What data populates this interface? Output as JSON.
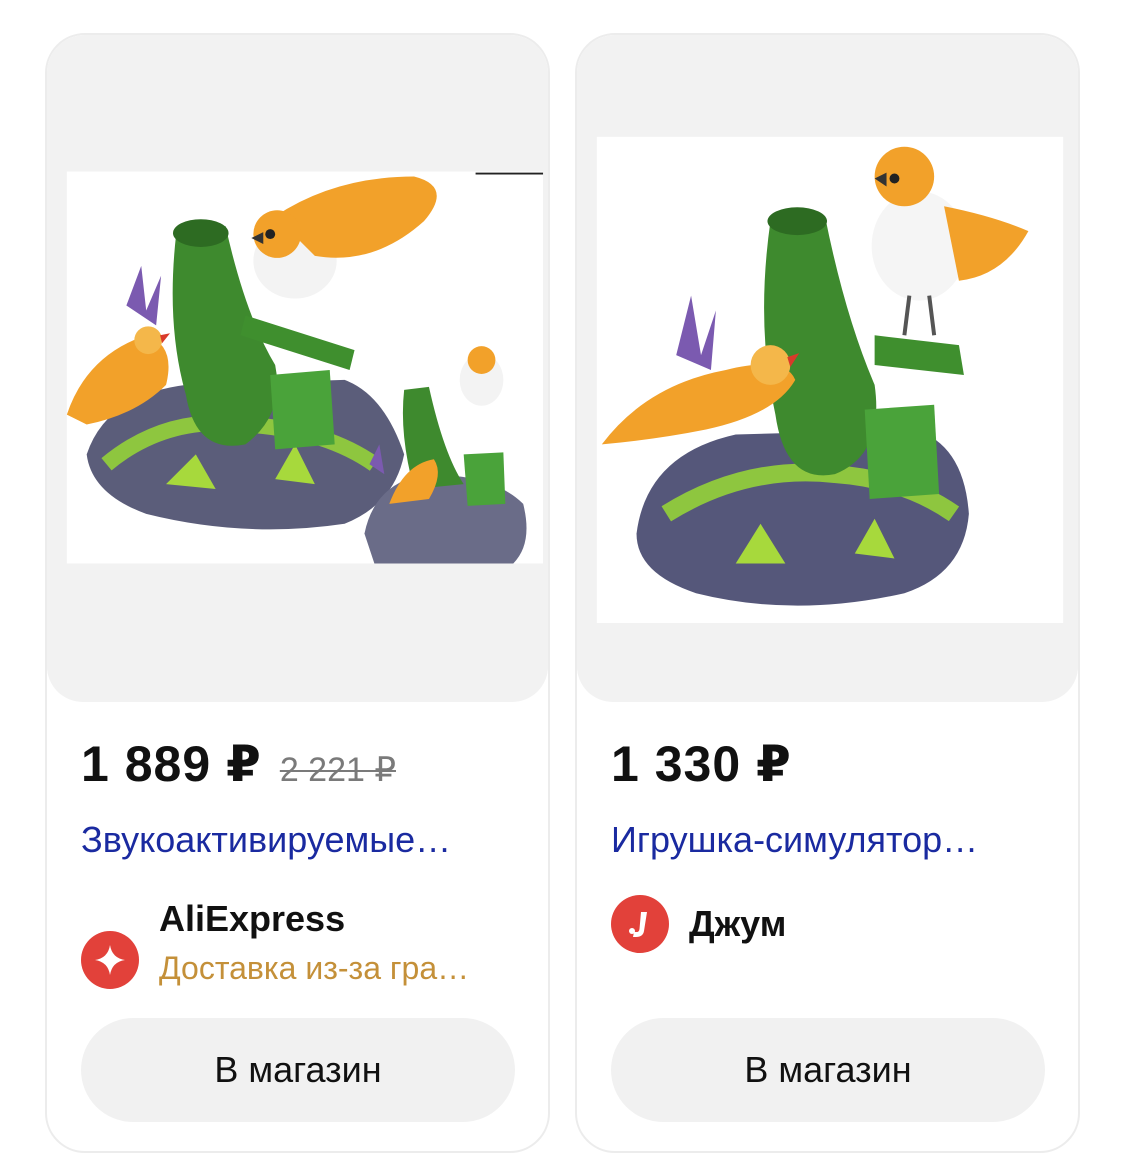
{
  "products": [
    {
      "price": "1 889 ₽",
      "old_price": "2 221 ₽",
      "title": "Звукоактивируемые…",
      "shop_name": "AliExpress",
      "shop_note": "Доставка из-за гра…",
      "button_label": "В магазин",
      "shop_logo_icon": "aliexpress-logo-icon",
      "image": "bird-toy-product-photo"
    },
    {
      "price": "1 330 ₽",
      "title": "Игрушка-симулятор…",
      "shop_name": "Джум",
      "button_label": "В магазин",
      "shop_logo_icon": "joom-logo-icon",
      "image": "bird-toy-product-photo"
    }
  ],
  "colors": {
    "title_link": "#1a2aa0",
    "delivery_note": "#c49039",
    "logo_red": "#e2413a",
    "button_bg": "#f1f1f1"
  }
}
